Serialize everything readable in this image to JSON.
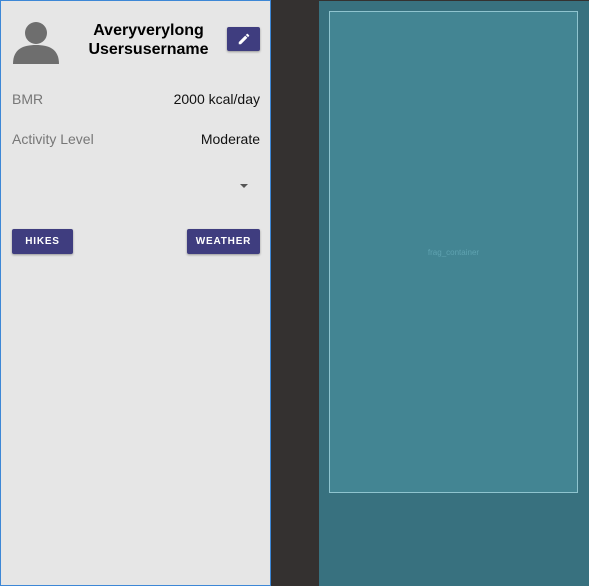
{
  "profile": {
    "username": "Averyverylong\nUsersusername",
    "avatar_icon": "person-silhouette-icon",
    "edit_icon": "pencil-icon",
    "bmr": {
      "label": "BMR",
      "value": "2000 kcal/day"
    },
    "activity": {
      "label": "Activity Level",
      "value": "Moderate"
    },
    "spinner": {
      "selected": "",
      "arrow_icon": "dropdown-arrow-icon"
    },
    "buttons": {
      "hikes": "HIKES",
      "weather": "WEATHER"
    }
  },
  "fragment": {
    "label": "frag_container"
  },
  "colors": {
    "accent": "#3f3d7f",
    "panel_bg": "#e6e6e6",
    "frag_bg": "#438593",
    "frag_outer": "#38717f",
    "divider": "#343130"
  }
}
